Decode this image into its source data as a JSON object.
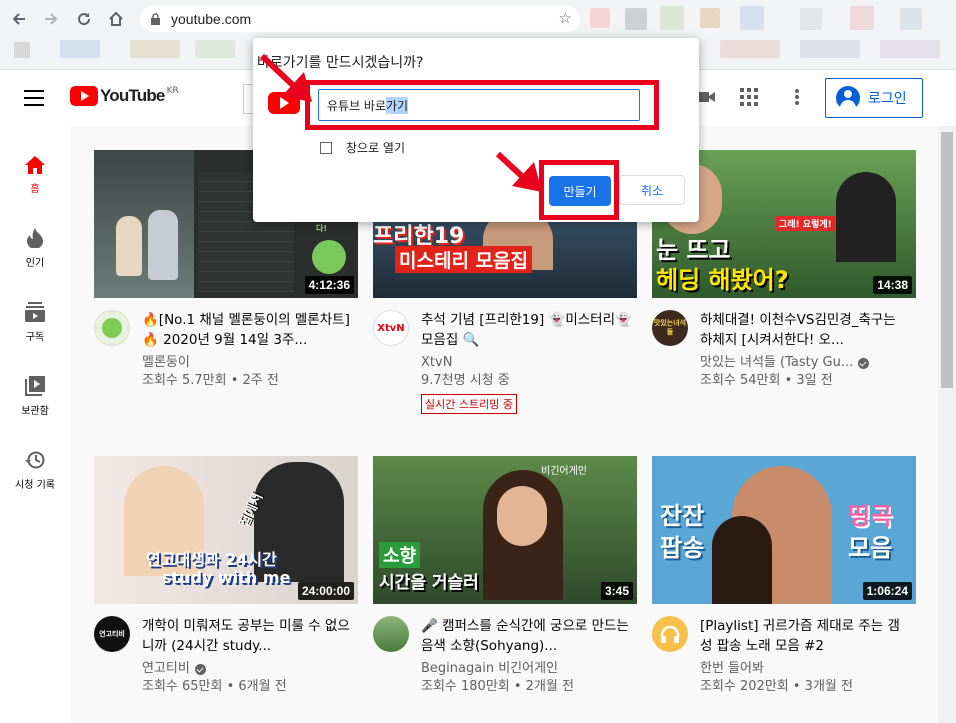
{
  "browser": {
    "url": "youtube.com",
    "icons": [
      "back-icon",
      "forward-icon",
      "reload-icon",
      "home-icon",
      "lock-icon",
      "star-icon"
    ]
  },
  "header": {
    "logo_text": "YouTube",
    "logo_region": "KR",
    "login_label": "로그인"
  },
  "sidebar": {
    "items": [
      {
        "label": "홈",
        "icon": "home-icon"
      },
      {
        "label": "인기",
        "icon": "fire-icon"
      },
      {
        "label": "구독",
        "icon": "subscriptions-icon"
      },
      {
        "label": "보관함",
        "icon": "library-icon"
      },
      {
        "label": "시청 기록",
        "icon": "history-icon"
      }
    ]
  },
  "dialog": {
    "title": "바로가기를 만드시겠습니까?",
    "input_value_plain": "유튜브 바로",
    "input_value_selected": "가기",
    "open_window_label": "창으로 열기",
    "create_label": "만들기",
    "cancel_label": "취소",
    "highlight_color": "#e8001c",
    "primary_color": "#1a73e8"
  },
  "videos": [
    {
      "title": "🔥[No.1 채널 멜론둥이의 멜론차트]🔥 2020년 9월 14일 3주...",
      "channel": "멜론둥이",
      "verified": false,
      "stats": "조회수 5.7만회 • 2주 전",
      "duration": "4:12:36",
      "thumb_text": [
        "감사합니다!"
      ],
      "avatar_text": ""
    },
    {
      "title": "추석 기념 [프리한19] 👻미스터리👻 모음집 🔍",
      "channel": "XtvN",
      "verified": false,
      "stats": "9.7천명 시청 중",
      "live_badge": "실시간 스트리밍 중",
      "duration": "",
      "thumb_text": [
        "프리한19",
        "미스테리 모음집"
      ],
      "avatar_text": "XtvN"
    },
    {
      "title": "하체대결! 이천수VS김민경_축구는 하체지 [시켜서한다! 오...",
      "channel": "맛있는 녀석들 (Tasty Gu...",
      "verified": true,
      "stats": "조회수 54만회 • 3일 전",
      "duration": "14:38",
      "thumb_text": [
        "그래! 요렇게!",
        "눈 뜨고",
        "헤딩 해봤어?"
      ],
      "avatar_text": "맛있는녀석들"
    },
    {
      "title": "개학이 미뤄져도 공부는 미룰 수 없으니까 (24시간 study...",
      "channel": "연고티비",
      "verified": true,
      "stats": "조회수 65만회 • 6개월 전",
      "duration": "24:00:00",
      "thumb_text": [
        "집에서",
        "연고대생과 24시간",
        "study with me"
      ],
      "avatar_text": "연고티비"
    },
    {
      "title": "🎤 캠퍼스를 순식간에 궁으로 만드는 음색 소향(Sohyang)...",
      "channel": "Beginagain 비긴어게인",
      "verified": false,
      "stats": "조회수 180만회 • 2개월 전",
      "duration": "3:45",
      "thumb_text": [
        "비긴어게인",
        "소향",
        "시간을 거슬러"
      ],
      "avatar_text": ""
    },
    {
      "title": "[Playlist] 귀르가즘 제대로 주는 갬성 팝송 노래 모음 #2",
      "channel": "한번 들어봐",
      "verified": false,
      "stats": "조회수 202만회 • 3개월 전",
      "duration": "1:06:24",
      "thumb_text": [
        "잔잔",
        "팝송",
        "띵곡",
        "모음"
      ],
      "avatar_text": ""
    }
  ]
}
